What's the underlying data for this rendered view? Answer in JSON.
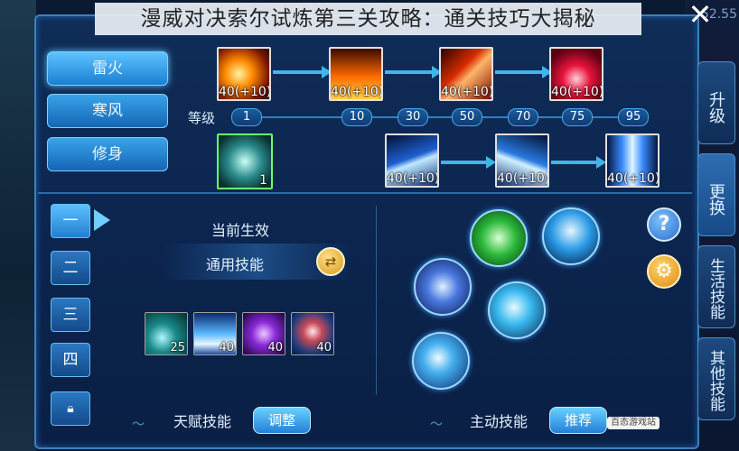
{
  "title": "漫威对决索尔试炼第三关攻略：通关技巧大揭秘",
  "close_icon": "close-icon",
  "tabs": [
    {
      "label": "雷火",
      "active": true
    },
    {
      "label": "寒风",
      "active": false
    },
    {
      "label": "修身",
      "active": false
    }
  ],
  "upgrade_row": {
    "skills": [
      {
        "icon": "fireball-icon",
        "level": "40(+10)"
      },
      {
        "icon": "flame-burst-icon",
        "level": "40(+10)"
      },
      {
        "icon": "fire-slash-icon",
        "level": "40(+10)"
      },
      {
        "icon": "crimson-burst-icon",
        "level": "40(+10)"
      }
    ]
  },
  "level_track": {
    "label": "等级",
    "levels": [
      "1",
      "10",
      "30",
      "50",
      "70",
      "75",
      "95"
    ]
  },
  "lightning_row": {
    "root": {
      "icon": "thunder-fist-icon",
      "level": "1"
    },
    "skills": [
      {
        "icon": "lightning-bolt-icon",
        "level": "40(+10)"
      },
      {
        "icon": "lightning-arc-icon",
        "level": "40(+10)"
      },
      {
        "icon": "lightning-storm-icon",
        "level": "40(+10)"
      }
    ]
  },
  "pages": [
    "一",
    "二",
    "三",
    "四"
  ],
  "lock_icon": "lock-icon",
  "current_effect": "当前生效",
  "general_skills": "通用技能",
  "talents": [
    {
      "icon": "ice-shard-icon",
      "level": "25"
    },
    {
      "icon": "ice-burst-icon",
      "level": "40"
    },
    {
      "icon": "void-strike-icon",
      "level": "40"
    },
    {
      "icon": "shield-gem-icon",
      "level": "40"
    }
  ],
  "active_skills": [
    {
      "icon": "sprint-icon"
    },
    {
      "icon": "silhouette-icon"
    },
    {
      "icon": "ice-spikes-icon"
    },
    {
      "icon": "frost-dash-icon"
    },
    {
      "icon": "frost-orb-icon"
    }
  ],
  "talent_label": "天赋技能",
  "adjust_btn": "调整",
  "active_label": "主动技能",
  "recommend_btn": "推荐",
  "side_tabs": [
    "升级",
    "更换",
    "生活技能",
    "其他技能"
  ],
  "watermark": "百态游戏站",
  "top_right_value": "52.55",
  "colors": {
    "accent": "#3fb6e8",
    "panel": "#0f2d57",
    "border": "#3c7fc0"
  }
}
